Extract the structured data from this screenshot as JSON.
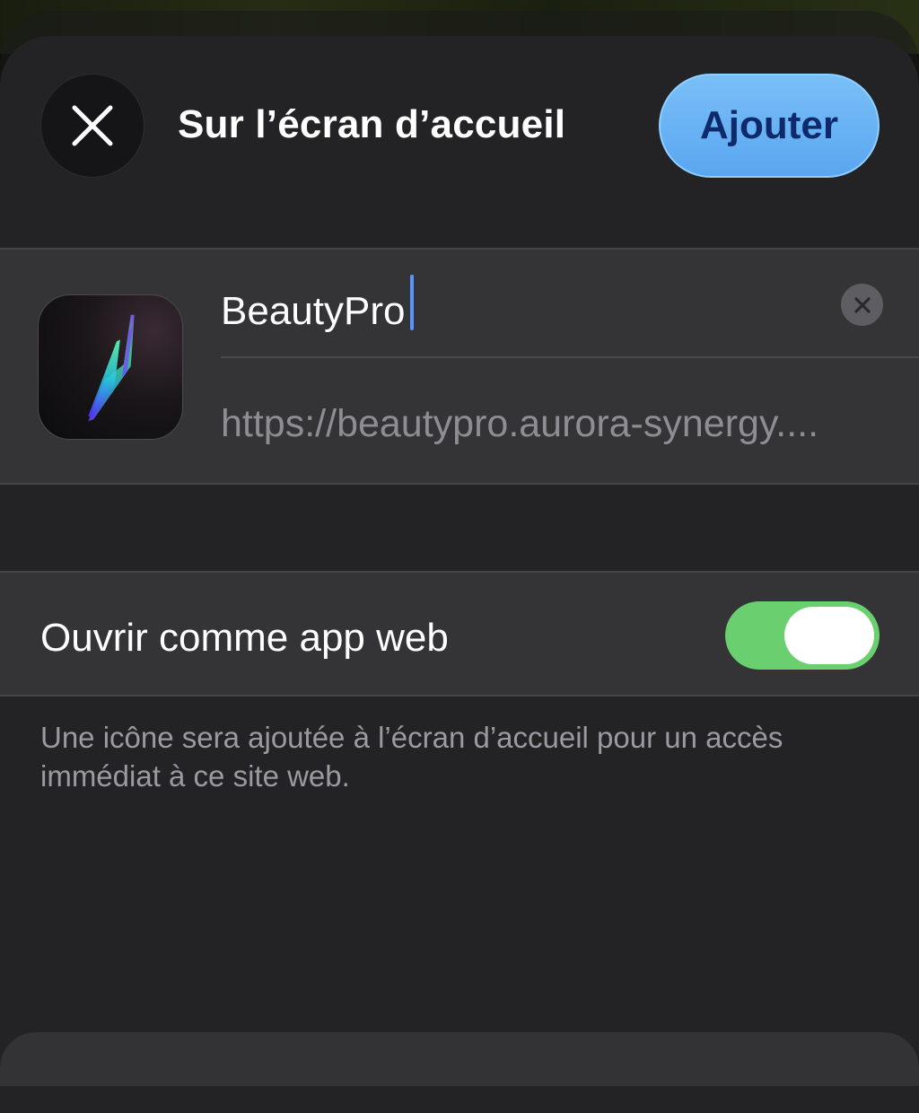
{
  "header": {
    "title": "Sur l’écran d’accueil",
    "add_label": "Ajouter"
  },
  "app": {
    "name_value": "BeautyPro",
    "url": "https://beautypro.aurora-synergy...."
  },
  "settings": {
    "open_as_web_app_label": "Ouvrir comme app web",
    "open_as_web_app_enabled": true
  },
  "footnote": "Une icône sera ajoutée à l’écran d’accueil pour un accès immédiat à ce site web.",
  "colors": {
    "accent": "#5aa6f0",
    "toggle_on": "#6ad06f",
    "sheet_background": "#232325",
    "group_background": "#343436"
  },
  "icons": {
    "close": "close-icon",
    "clear": "clear-text-icon"
  }
}
